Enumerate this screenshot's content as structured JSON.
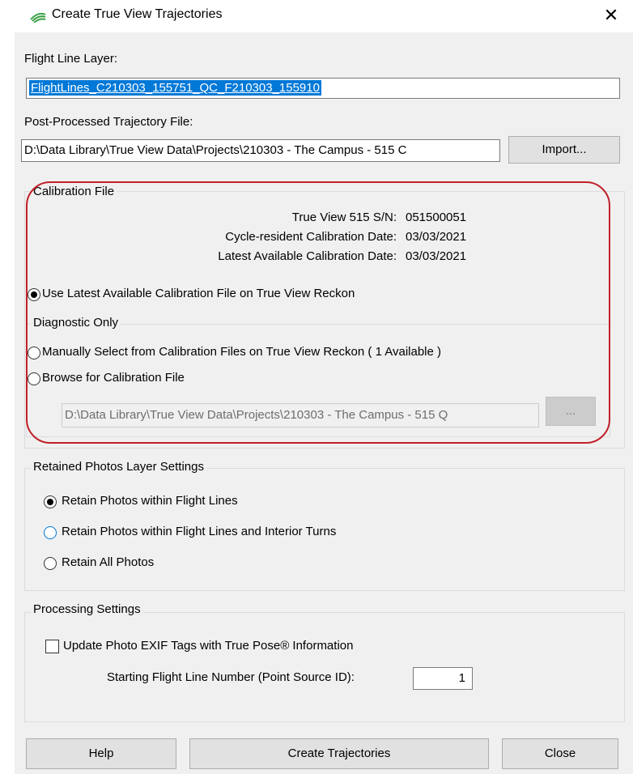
{
  "window": {
    "title": "Create True View Trajectories",
    "close_glyph": "✕",
    "app_icon": "green-wave-icon"
  },
  "flight_line": {
    "label": "Flight Line Layer:",
    "value": "FlightLines_C210303_155751_QC_F210303_155910"
  },
  "trajectory": {
    "label": "Post-Processed Trajectory File:",
    "value": "D:\\Data Library\\True View Data\\Projects\\210303 - The Campus - 515 C",
    "import_label": "Import..."
  },
  "calibration": {
    "title": "Calibration File",
    "sn_label": "True View 515 S/N:",
    "sn_value": "051500051",
    "cycle_label": "Cycle-resident Calibration Date:",
    "cycle_value": "03/03/2021",
    "latest_label": "Latest Available Calibration Date:",
    "latest_value": "03/03/2021",
    "use_latest_label": "Use Latest Available Calibration File on True View Reckon",
    "diagnostic": {
      "title": "Diagnostic Only",
      "manual_label": "Manually Select from Calibration Files on True View Reckon ( 1 Available )",
      "browse_label": "Browse for Calibration File",
      "browse_path": "D:\\Data Library\\True View Data\\Projects\\210303 - The Campus - 515 Q",
      "browse_button": "..."
    }
  },
  "photos": {
    "title": "Retained Photos Layer Settings",
    "opt1": "Retain Photos within Flight Lines",
    "opt2": "Retain Photos within Flight Lines and Interior Turns",
    "opt3": "Retain All Photos"
  },
  "processing": {
    "title": "Processing Settings",
    "exif_label": "Update Photo EXIF Tags with True Pose® Information",
    "start_label": "Starting Flight Line Number (Point Source ID):",
    "start_value": "1"
  },
  "buttons": {
    "help": "Help",
    "create": "Create Trajectories",
    "close": "Close"
  },
  "colors": {
    "accent": "#0078d7",
    "highlight": "#c0202a"
  }
}
